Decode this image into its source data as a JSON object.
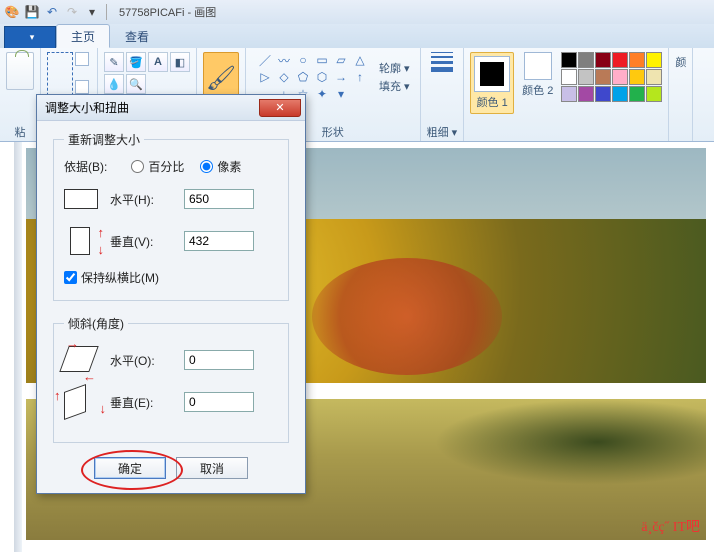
{
  "window": {
    "title": "57758PICAFi - 画图"
  },
  "qat": {
    "app_icon": "🎨",
    "save_icon": "💾",
    "undo_icon": "↶",
    "redo_icon": "↷",
    "down_icon": "▾"
  },
  "tabs": {
    "home": "主页",
    "view": "查看"
  },
  "ribbon": {
    "clipboard": {
      "label": "粘",
      "paste": "粘"
    },
    "shapes_label": "形状",
    "shape_opts": {
      "outline": "轮廓 ▾",
      "fill": "填充 ▾"
    },
    "size": {
      "label": "粗细 ▾"
    },
    "colors": {
      "c1_label": "颜色 1",
      "c2_label": "颜色 2",
      "edit_label": "颜"
    },
    "palette": [
      "#000000",
      "#7f7f7f",
      "#880015",
      "#ed1c24",
      "#ff7f27",
      "#fff200",
      "#ffffff",
      "#c3c3c3",
      "#b97a57",
      "#ffaec9",
      "#ffc90e",
      "#efe4b0",
      "#c8bfe7",
      "#a349a4",
      "#3f48cc",
      "#00a2e8",
      "#22b14c",
      "#b5e61d"
    ]
  },
  "dialog": {
    "title": "调整大小和扭曲",
    "close": "✕",
    "resize_legend": "重新调整大小",
    "by_label": "依据(B):",
    "percent": "百分比",
    "pixel": "像素",
    "h_label": "水平(H):",
    "v_label": "垂直(V):",
    "h_value": "650",
    "v_value": "432",
    "keep_aspect": "保持纵横比(M)",
    "skew_legend": "倾斜(角度)",
    "so_label": "水平(O):",
    "se_label": "垂直(E):",
    "so_value": "0",
    "se_value": "0",
    "ok": "确定",
    "cancel": "取消"
  },
  "watermark": "ä¸čç˝ IT吧"
}
